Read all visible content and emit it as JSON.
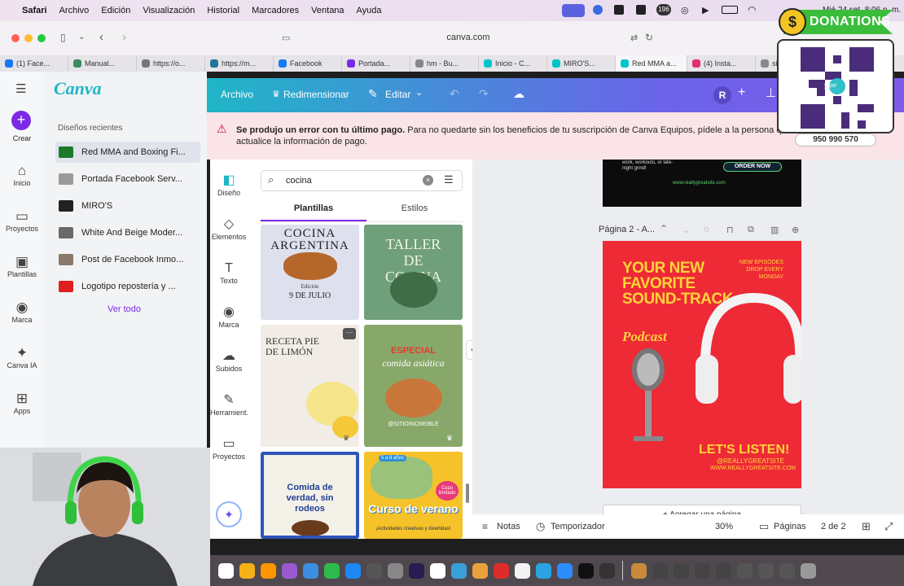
{
  "menubar": {
    "apple": "",
    "items": [
      "Safari",
      "Archivo",
      "Edición",
      "Visualización",
      "Historial",
      "Marcadores",
      "Ventana",
      "Ayuda"
    ],
    "clock": "Mié 24 set. 8:06 p. m.",
    "badge": "196"
  },
  "safari": {
    "url": "canva.com"
  },
  "tabs": [
    {
      "label": "(1) Face...",
      "color": "#1877f2"
    },
    {
      "label": "Manual...",
      "color": "#3b8c5a"
    },
    {
      "label": "https://o...",
      "color": "#777"
    },
    {
      "label": "https://m...",
      "color": "#21759b"
    },
    {
      "label": "Facebook",
      "color": "#1877f2"
    },
    {
      "label": "Portada...",
      "color": "#7d2ae8"
    },
    {
      "label": "hm - Bu...",
      "color": "#888"
    },
    {
      "label": "Inicio - C...",
      "color": "#00c4cc"
    },
    {
      "label": "MIRO'S...",
      "color": "#00c4cc"
    },
    {
      "label": "Red MMA a...",
      "color": "#00c4cc"
    },
    {
      "label": "(4) Insta...",
      "color": "#e1306c"
    },
    {
      "label": "si",
      "color": "#888"
    }
  ],
  "canva": {
    "logo": "Canva",
    "create": "Crear",
    "rail": [
      {
        "label": "Inicio",
        "icon": "home-icon",
        "glyph": "⌂"
      },
      {
        "label": "Proyectos",
        "icon": "folder-icon",
        "glyph": "▭"
      },
      {
        "label": "Plantillas",
        "icon": "templates-icon",
        "glyph": "▣"
      },
      {
        "label": "Marca",
        "icon": "brand-icon",
        "glyph": "◉"
      },
      {
        "label": "Canva IA",
        "icon": "sparkle-icon",
        "glyph": "✦"
      },
      {
        "label": "Apps",
        "icon": "apps-icon",
        "glyph": "⊞"
      }
    ],
    "recent_title": "Diseños recientes",
    "recent": [
      {
        "label": "Red MMA and Boxing Fi...",
        "color": "#1a7a2a"
      },
      {
        "label": "Portada Facebook Serv...",
        "color": "#9a9a9a"
      },
      {
        "label": "MIRO'S",
        "color": "#222"
      },
      {
        "label": "White And Beige Moder...",
        "color": "#6a6a6a"
      },
      {
        "label": "Post de Facebook Inmo...",
        "color": "#8a7a6a"
      },
      {
        "label": "Logotipo repostería y ...",
        "color": "#e02020"
      }
    ],
    "see_all": "Ver todo"
  },
  "header": {
    "file": "Archivo",
    "resize": "Redimensionar",
    "edit": "Editar",
    "avatar": "R"
  },
  "banner": {
    "bold": "Se produjo un error con tu último pago.",
    "rest": " Para no quedarte sin los beneficios de tu suscripción de Canva Equipos, pídele a la persona que",
    "line2": "actualice la información de pago."
  },
  "tools": [
    {
      "label": "Diseño",
      "icon": "design-icon",
      "glyph": "◧"
    },
    {
      "label": "Elementos",
      "icon": "elements-icon",
      "glyph": "◇"
    },
    {
      "label": "Texto",
      "icon": "text-icon",
      "glyph": "T"
    },
    {
      "label": "Marca",
      "icon": "brand-icon",
      "glyph": "◉"
    },
    {
      "label": "Subidos",
      "icon": "upload-icon",
      "glyph": "☁"
    },
    {
      "label": "Herramient...",
      "icon": "tools-icon",
      "glyph": "✎"
    },
    {
      "label": "Proyectos",
      "icon": "folder-icon",
      "glyph": "▭"
    }
  ],
  "panel": {
    "search_value": "cocina",
    "tab1": "Plantillas",
    "tab2": "Estilos"
  },
  "templates": {
    "t1": {
      "title": "COCINA ARGENTINA",
      "date": "9 DE JULIO",
      "sub": "Edición"
    },
    "t2": {
      "title": "TALLER DE COCINA"
    },
    "t3": {
      "title": "RECETA PIE DE LIMÓN"
    },
    "t4": {
      "title": "ESPECIAL",
      "sub": "comida asiática",
      "tag": "@SITIOINCREIBLE"
    },
    "t5": {
      "title": "Comida de verdad, sin rodeos"
    },
    "t6": {
      "title": "Curso de verano",
      "sub": "¡Actividades creativas y divertidas!",
      "age": "5 a 8 años",
      "cupo": "Cupo limitado"
    }
  },
  "page1": {
    "button": "ORDER NOW",
    "lines": "work, workouts, or late-night grind!",
    "site": "www.reallygreatsite.com"
  },
  "page2": {
    "label": "Página 2 - A...",
    "headline": "YOUR NEW FAVORITE SOUND-TRACK",
    "podcast": "Podcast",
    "episodes": "NEW EPISODES DROP EVERY MONDAY",
    "cta": "LET'S LISTEN!",
    "handle": "@REALLYGREATSITE",
    "site": "WWW.REALLYGREATSITE.COM"
  },
  "add_page": "+ Agregar una página",
  "bottom": {
    "notes": "Notas",
    "timer": "Temporizador",
    "zoom": "30%",
    "pages": "Páginas",
    "count": "2 de 2"
  },
  "donations": {
    "title": "DONATIONS",
    "phone": "950 990 570",
    "coin": "$",
    "qr_brand": "yape"
  },
  "colors": {
    "accent": "#7d2ae8",
    "teal": "#1fb6c7",
    "poster": "#ee2a36"
  }
}
